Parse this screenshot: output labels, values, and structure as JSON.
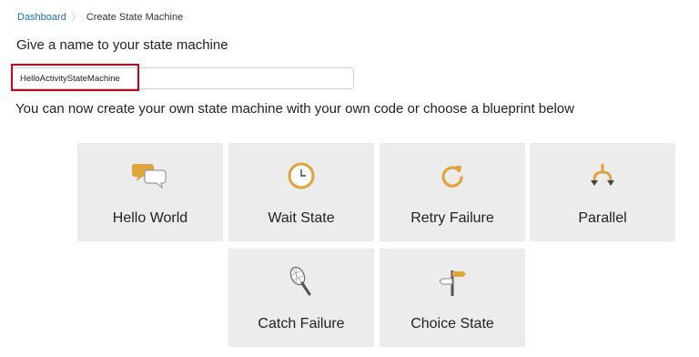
{
  "breadcrumb": {
    "home": "Dashboard",
    "separator": "〉",
    "current": "Create State Machine"
  },
  "name_section": {
    "heading": "Give a name to your state machine",
    "input_value": "HelloActivityStateMachine"
  },
  "blueprints": {
    "intro": "You can now create your own state machine with your own code or choose a blueprint below",
    "items": [
      {
        "label": "Hello World",
        "icon": "speech-bubbles-icon"
      },
      {
        "label": "Wait State",
        "icon": "clock-icon"
      },
      {
        "label": "Retry Failure",
        "icon": "retry-arrow-icon"
      },
      {
        "label": "Parallel",
        "icon": "parallel-branch-icon"
      },
      {
        "label": "Catch Failure",
        "icon": "net-icon"
      },
      {
        "label": "Choice State",
        "icon": "signpost-icon"
      }
    ]
  },
  "colors": {
    "accent": "#e0a53a",
    "tile_bg": "#ececec",
    "highlight": "#d0021b",
    "link": "#1a6fb8"
  }
}
